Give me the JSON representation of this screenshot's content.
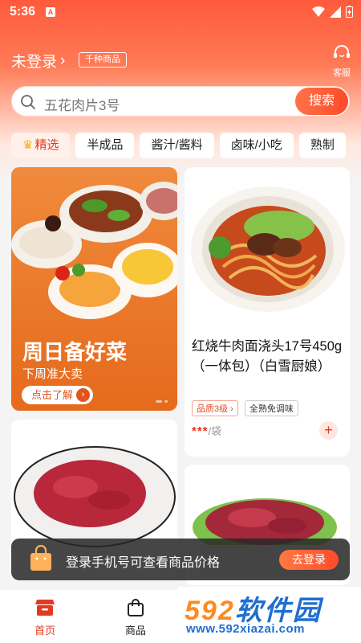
{
  "status_bar": {
    "time": "5:36",
    "notification_letter": "A"
  },
  "header": {
    "login_label": "未登录",
    "login_chevron": "›",
    "goods_badge": "千种商品",
    "service_label": "客服"
  },
  "search": {
    "placeholder": "五花肉片3号",
    "button_label": "搜索"
  },
  "categories": [
    {
      "label": "精选",
      "active": true
    },
    {
      "label": "半成品"
    },
    {
      "label": "酱汁/酱料"
    },
    {
      "label": "卤味/小吃"
    },
    {
      "label": "熟制"
    }
  ],
  "promo": {
    "title": "周日备好菜",
    "subtitle": "下周准大卖",
    "button_label": "点击了解",
    "button_arrow": "›"
  },
  "products": [
    {
      "name": "红烧牛肉面浇头17号450g（一体包）（白雪厨娘）",
      "quality_tag": "品质3级 ›",
      "tag": "全熟免调味",
      "price_masked": "***",
      "unit": "/袋",
      "add_symbol": "+"
    }
  ],
  "login_prompt": {
    "text": "登录手机号可查看商品价格",
    "button_label": "去登录"
  },
  "bottom_nav": [
    {
      "label": "首页",
      "active": true
    },
    {
      "label": "商品"
    }
  ],
  "watermark": {
    "brand_main": "592",
    "brand_rest": "软件园",
    "url": "www.592xiazai.com"
  },
  "colors": {
    "brand": "#ff5a3c",
    "accent_red": "#e23a20",
    "banner_dark": "#282828"
  }
}
